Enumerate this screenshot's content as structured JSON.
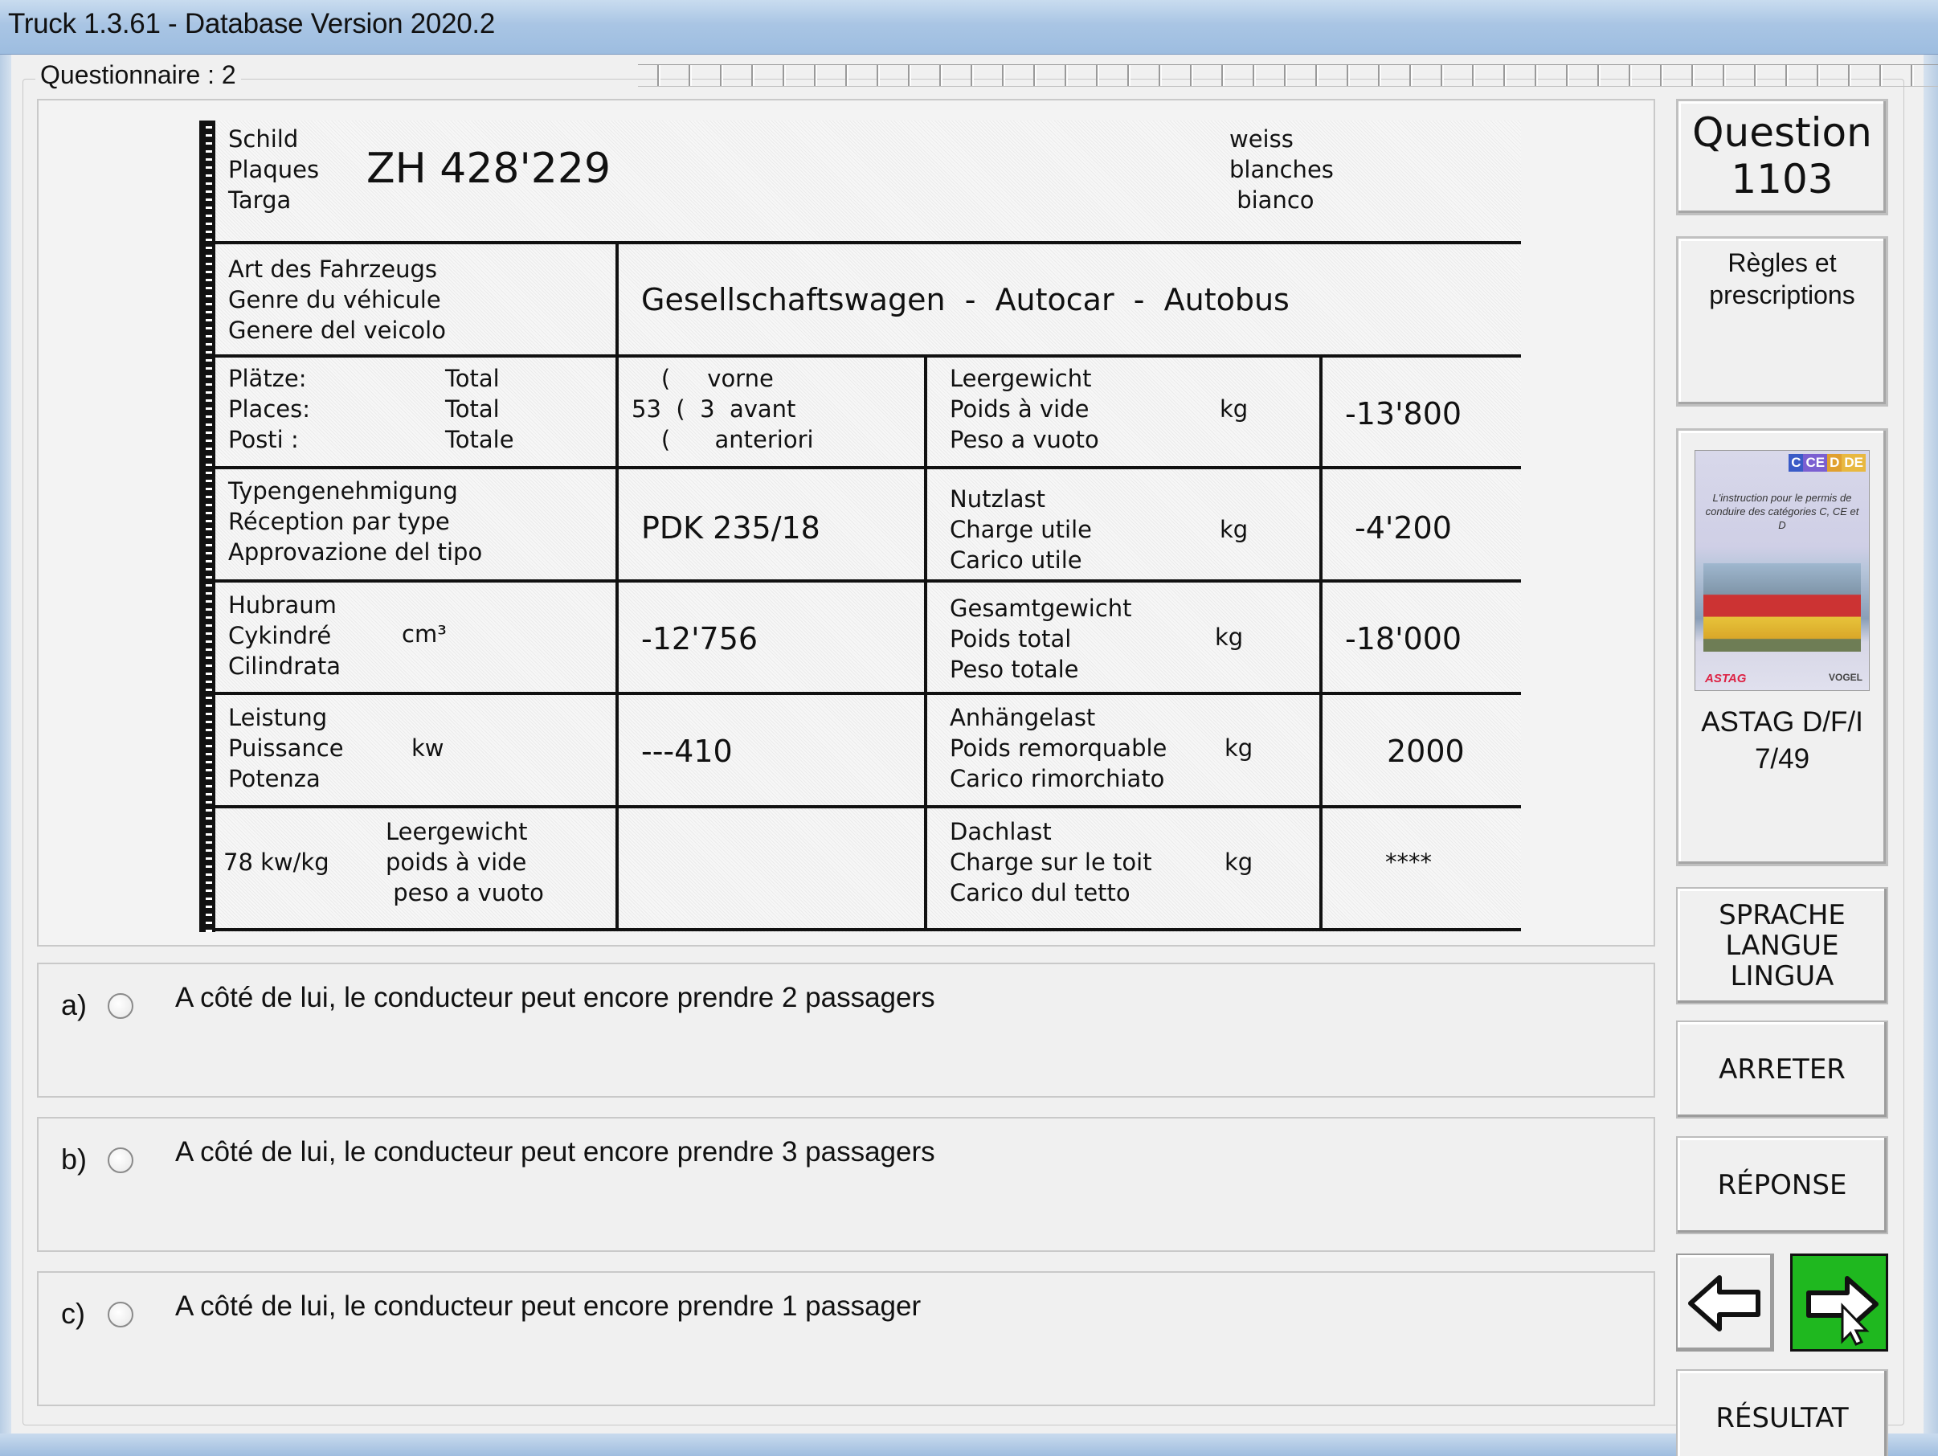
{
  "window": {
    "title": "Truck 1.3.61 - Database Version 2020.2"
  },
  "questionnaire": {
    "label": "Questionnaire : 2"
  },
  "document": {
    "plate_labels": "Schild\nPlaques\nTarga",
    "plate_number": "ZH 428'229",
    "plate_color": "weiss\nblanches\n bianco",
    "vehicle_type_labels": "Art des Fahrzeugs\nGenre du véhicule\nGenere del veicolo",
    "vehicle_type_value": "Gesellschaftswagen  -  Autocar  -  Autobus",
    "seats_labels": "Plätze:\nPlaces:\nPosti :",
    "seats_total": "Total\nTotal\nTotale",
    "seats_front": "    (     vorne\n53  (  3  avant\n    (      anteriori",
    "empty_weight_labels": "Leergewicht\nPoids à vide\nPeso a vuoto",
    "unit_kg": "kg",
    "empty_weight_value": "-13'800",
    "type_approval_labels": "Typengenehmigung\nRéception par type\nApprovazione del tipo",
    "type_approval_value": "PDK 235/18",
    "payload_labels": "Nutzlast\nCharge utile\nCarico utile",
    "payload_value": "-4'200",
    "displacement_labels": "Hubraum\nCykindré\nCilindrata",
    "displacement_unit": "cm³",
    "displacement_value": "-12'756",
    "total_weight_labels": "Gesamtgewicht\nPoids total\nPeso totale",
    "total_weight_value": "-18'000",
    "power_labels": "Leistung\nPuissance\nPotenza",
    "power_unit": "kw",
    "power_value": "---410",
    "trailer_labels": "Anhängelast\nPoids remorquable\nCarico rimorchiato",
    "trailer_value": "2000",
    "ratio_label": "78 kw/kg",
    "ratio_sub": "Leergewicht\npoids à vide\n peso a vuoto",
    "roof_labels": "Dachlast\nCharge sur le toit\nCarico dul tetto",
    "roof_value": "****"
  },
  "answers": [
    {
      "letter": "a)",
      "text": "A côté de lui, le conducteur peut encore prendre 2 passagers"
    },
    {
      "letter": "b)",
      "text": "A côté de lui, le conducteur peut encore prendre 3 passagers"
    },
    {
      "letter": "c)",
      "text": "A côté de lui, le conducteur peut encore prendre 1 passager"
    }
  ],
  "sidebar": {
    "question_label": "Question",
    "question_number": "1103",
    "rules_line1": "Règles et",
    "rules_line2": "prescriptions",
    "book": {
      "badges": [
        "C",
        "CE",
        "D",
        "DE"
      ],
      "subtitle": "L'instruction pour le permis de conduire des catégories C, CE et D",
      "logo_left": "ASTAG",
      "logo_right": "VOGEL"
    },
    "book_caption1": "ASTAG D/F/I",
    "book_caption2": "7/49",
    "language_line1": "SPRACHE",
    "language_line2": "LANGUE",
    "language_line3": "LINGUA",
    "stop_label": "ARRETER",
    "answer_label": "RÉPONSE",
    "result_label": "RÉSULTAT"
  },
  "colors": {
    "next_button": "#1fb81f",
    "title_bar": "#a9c5e4"
  }
}
